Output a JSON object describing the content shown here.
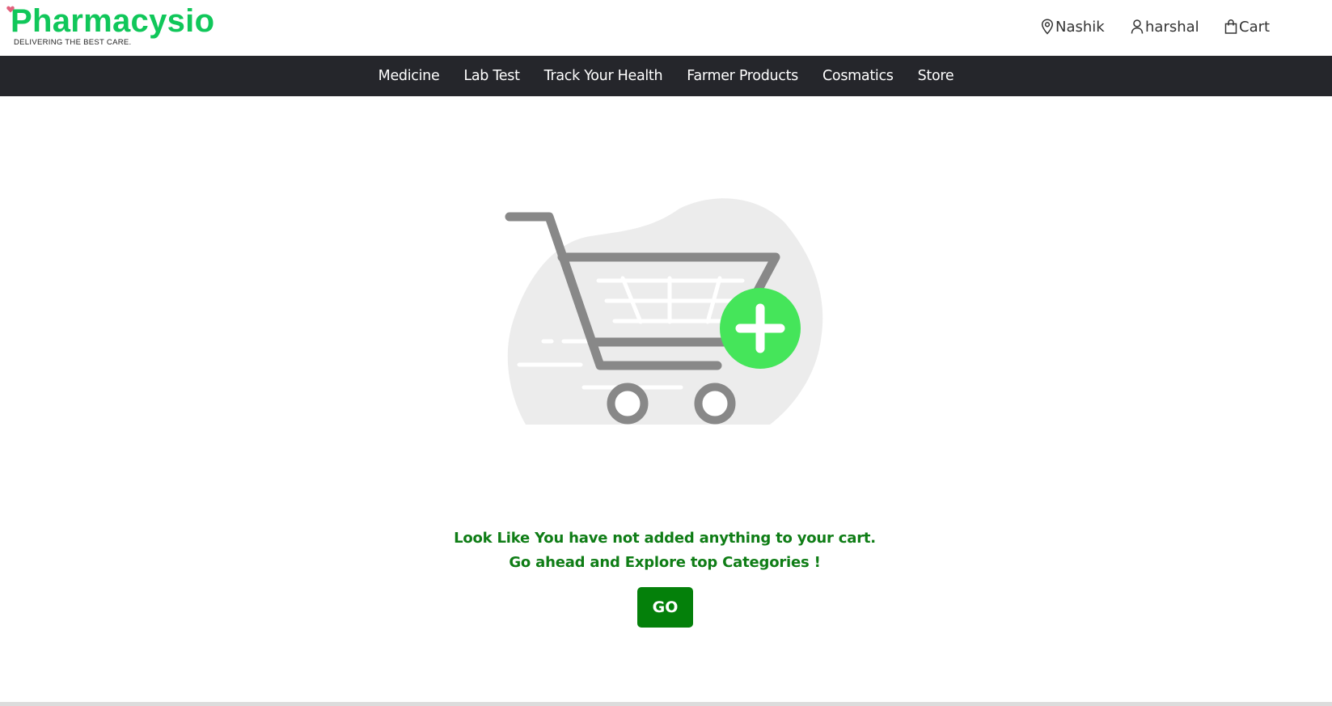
{
  "header": {
    "logo": {
      "title": "Pharmacysio",
      "tagline": "DELIVERING THE BEST CARE."
    },
    "location": {
      "icon": "map-pin-icon",
      "label": "Nashik"
    },
    "user": {
      "icon": "user-icon",
      "label": "harshal"
    },
    "cart": {
      "icon": "shopping-bag-icon",
      "label": "Cart"
    }
  },
  "nav": {
    "items": [
      {
        "label": "Medicine"
      },
      {
        "label": "Lab Test"
      },
      {
        "label": "Track Your Health"
      },
      {
        "label": "Farmer Products"
      },
      {
        "label": "Cosmatics"
      },
      {
        "label": "Store"
      }
    ]
  },
  "empty_cart": {
    "illustration_icon": "empty-cart-add-icon",
    "message": "Look Like You have not added anything to your cart. Go ahead and Explore top Categories !",
    "button_label": "GO"
  },
  "colors": {
    "brand_green": "#10c75a",
    "message_green": "#0f7d16",
    "button_green": "#04800a",
    "navbar": "#25262b",
    "plus_badge": "#45e55a"
  }
}
